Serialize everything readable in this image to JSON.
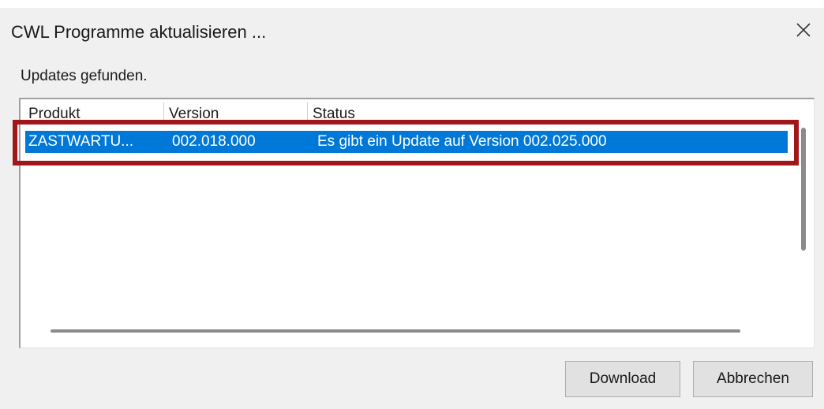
{
  "window": {
    "title": "CWL Programme aktualisieren ...",
    "close_icon": "close-icon"
  },
  "status": {
    "message": "Updates gefunden."
  },
  "list": {
    "columns": [
      "Produkt",
      "Version",
      "Status"
    ],
    "rows": [
      {
        "product": "ZASTWARTU...",
        "version": "002.018.000",
        "status": "Es gibt ein Update auf Version 002.025.000",
        "selected": true
      }
    ]
  },
  "buttons": {
    "download_label": "Download",
    "cancel_label": "Abbrechen"
  },
  "colors": {
    "selection": "#0078d7",
    "highlight_frame": "#a1161b"
  }
}
